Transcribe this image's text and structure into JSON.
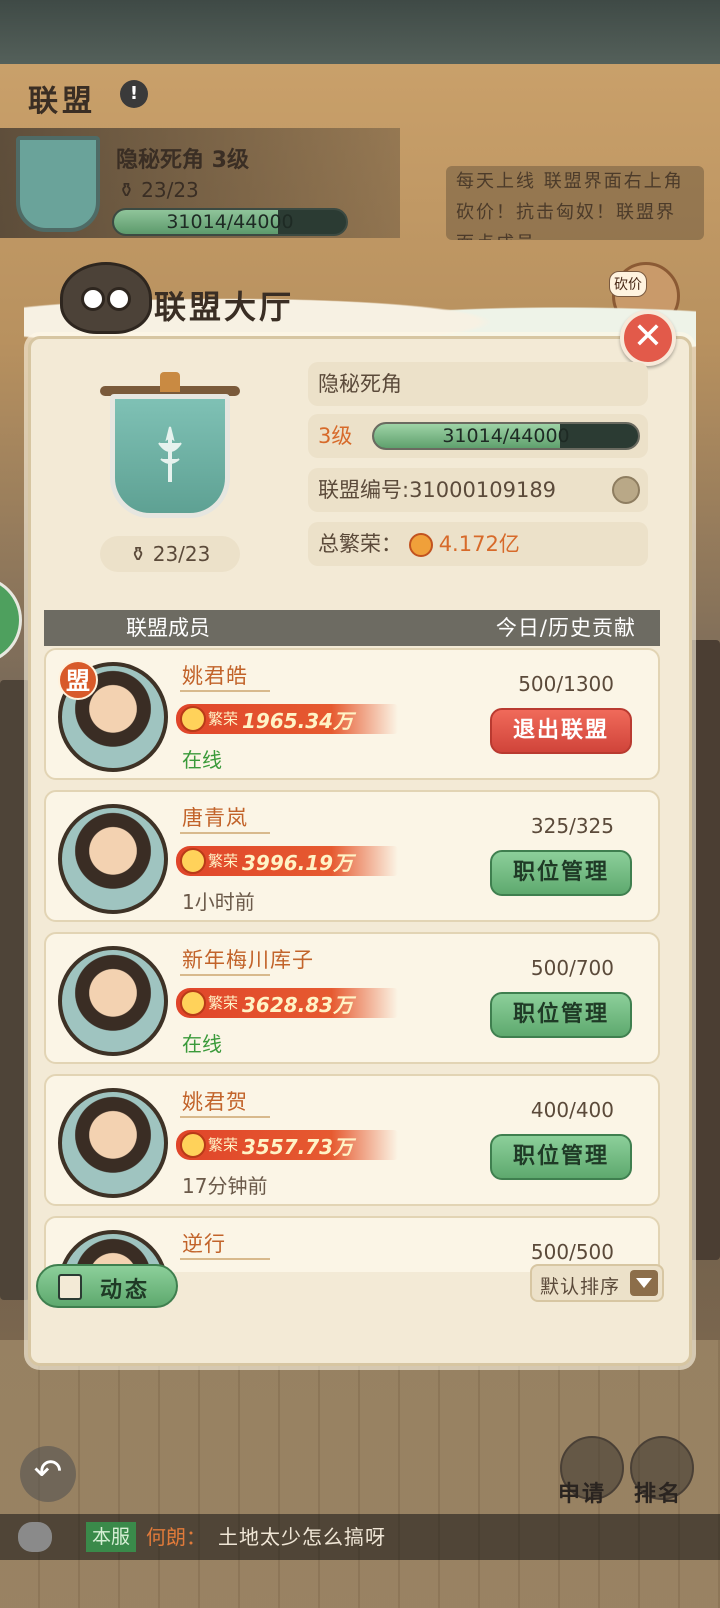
{
  "header": {
    "title": "联盟",
    "alliance_name": "隐秘死角 3级",
    "members": "23/23",
    "xp": "31014/44000",
    "xp_fraction": 0.705,
    "tip": "每天上线 联盟界面右上角砍价！抗击匈奴！联盟界面点成员",
    "kan_label": "砍价"
  },
  "panel": {
    "title": "联盟大厅",
    "close_label": "✕",
    "members": "23/23",
    "name": "隐秘死角",
    "level": "3级",
    "xp": "31014/44000",
    "xp_fraction": 0.705,
    "alliance_id": "联盟编号:31000109189",
    "prosperity_label": "总繁荣：",
    "prosperity_value": "4.172亿"
  },
  "list": {
    "col_members": "联盟成员",
    "col_contrib": "今日/历史贡献",
    "prosperity_tag": "繁荣",
    "items": [
      {
        "name": "姚君皓",
        "prosperity": "1965.34万",
        "status": "在线",
        "online": true,
        "contrib": "500/1300",
        "action": "退出联盟",
        "leader_badge": "盟"
      },
      {
        "name": "唐青岚",
        "prosperity": "3996.19万",
        "status": "1小时前",
        "online": false,
        "contrib": "325/325",
        "action": "职位管理"
      },
      {
        "name": "新年梅川库子",
        "prosperity": "3628.83万",
        "status": "在线",
        "online": true,
        "contrib": "500/700",
        "action": "职位管理"
      },
      {
        "name": "姚君贺",
        "prosperity": "3557.73万",
        "status": "17分钟前",
        "online": false,
        "contrib": "400/400",
        "action": "职位管理"
      },
      {
        "name": "逆行",
        "contrib": "500/500"
      }
    ]
  },
  "footer": {
    "dynamic_label": "动态",
    "sort_label": "默认排序"
  },
  "bottom": {
    "apply_label": "申请",
    "rank_label": "排名",
    "chat_tag": "本服",
    "chat_user": "何朗：",
    "chat_msg": "土地太少怎么搞呀"
  }
}
